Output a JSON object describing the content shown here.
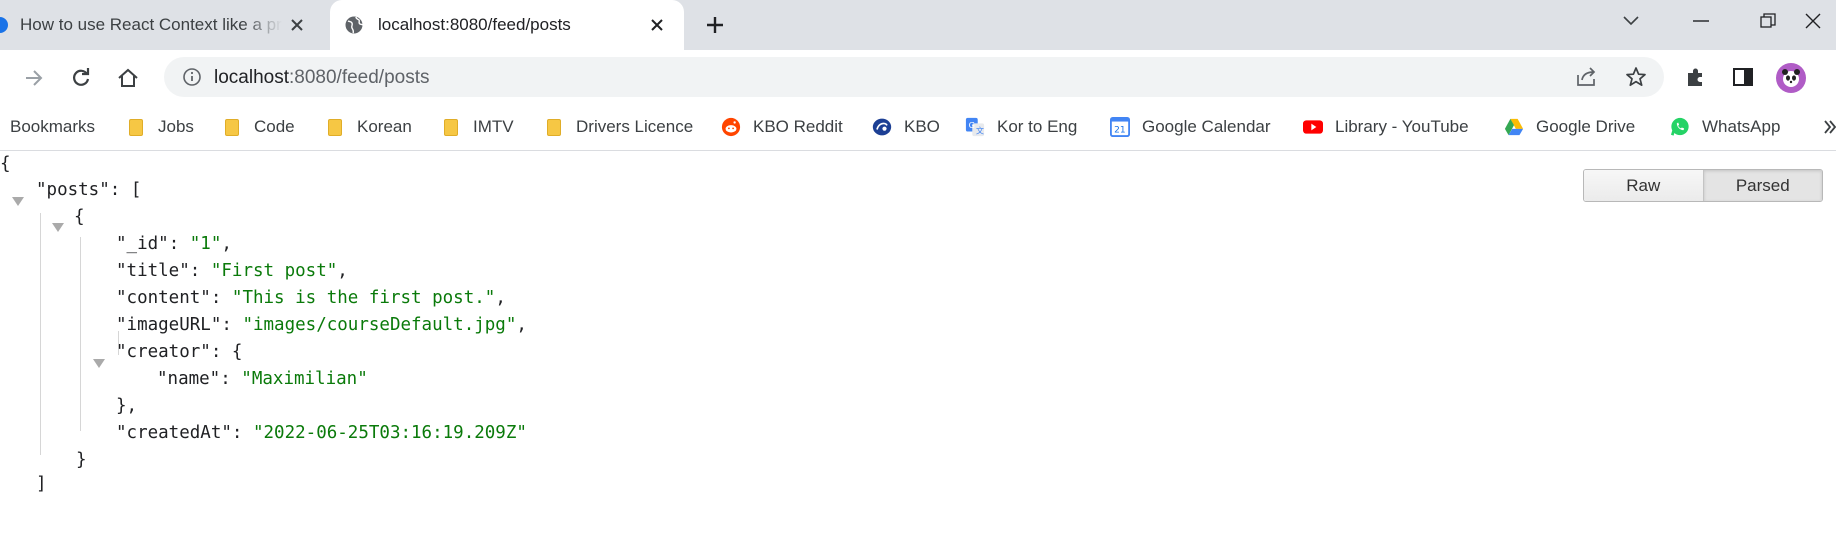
{
  "tabs": [
    {
      "title": "How to use React Context like a pro",
      "active": false
    },
    {
      "title": "localhost:8080/feed/posts",
      "active": true
    }
  ],
  "address": {
    "host": "localhost",
    "path": ":8080/feed/posts"
  },
  "bookmarks": {
    "label": "Bookmarks",
    "items": [
      {
        "label": "Jobs",
        "icon": "folder-icon"
      },
      {
        "label": "Code",
        "icon": "folder-icon"
      },
      {
        "label": "Korean",
        "icon": "folder-icon"
      },
      {
        "label": "IMTV",
        "icon": "folder-icon"
      },
      {
        "label": "Drivers Licence",
        "icon": "folder-icon"
      },
      {
        "label": "KBO Reddit",
        "icon": "reddit-icon"
      },
      {
        "label": "KBO",
        "icon": "kbo-icon"
      },
      {
        "label": "Kor to Eng",
        "icon": "google-translate-icon"
      },
      {
        "label": "Google Calendar",
        "icon": "google-calendar-icon"
      },
      {
        "label": "Library - YouTube",
        "icon": "youtube-icon"
      },
      {
        "label": "Google Drive",
        "icon": "google-drive-icon"
      },
      {
        "label": "WhatsApp",
        "icon": "whatsapp-icon"
      }
    ]
  },
  "viewer_toggle": {
    "raw": "Raw",
    "parsed": "Parsed",
    "selected": "Parsed"
  },
  "json": {
    "posts_key": "\"posts\"",
    "id_key": "\"_id\"",
    "id_val": "\"1\"",
    "title_key": "\"title\"",
    "title_val": "\"First post\"",
    "content_key": "\"content\"",
    "content_val": "\"This is the first post.\"",
    "image_key": "\"imageURL\"",
    "image_val": "\"images/courseDefault.jpg\"",
    "creator_key": "\"creator\"",
    "name_key": "\"name\"",
    "name_val": "\"Maximilian\"",
    "created_key": "\"createdAt\"",
    "created_val": "\"2022-06-25T03:16:19.209Z\""
  },
  "calendar_day": "21"
}
